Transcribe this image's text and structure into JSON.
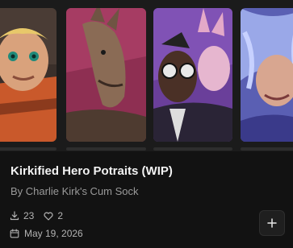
{
  "card": {
    "title": "Kirkified Hero Potraits (WIP)",
    "author": "By Charlie Kirk's Cum Sock",
    "downloads": "23",
    "likes": "2",
    "date": "May 19, 2026"
  },
  "thumbnails": [
    {
      "subject": "blond-hero-portrait",
      "accent": "#c9592b"
    },
    {
      "subject": "horse-hero-portrait",
      "accent": "#8e2f52"
    },
    {
      "subject": "goggles-hero-portrait",
      "accent": "#6a3f9a"
    },
    {
      "subject": "blue-hair-hero-portrait",
      "accent": "#9aa8e8"
    }
  ],
  "icons": {
    "downloads": "download-icon",
    "likes": "heart-icon",
    "date": "calendar-icon",
    "add": "plus-icon"
  },
  "colors": {
    "background": "#121212",
    "title": "#f2f2f2",
    "muted": "#9a9a9a"
  }
}
